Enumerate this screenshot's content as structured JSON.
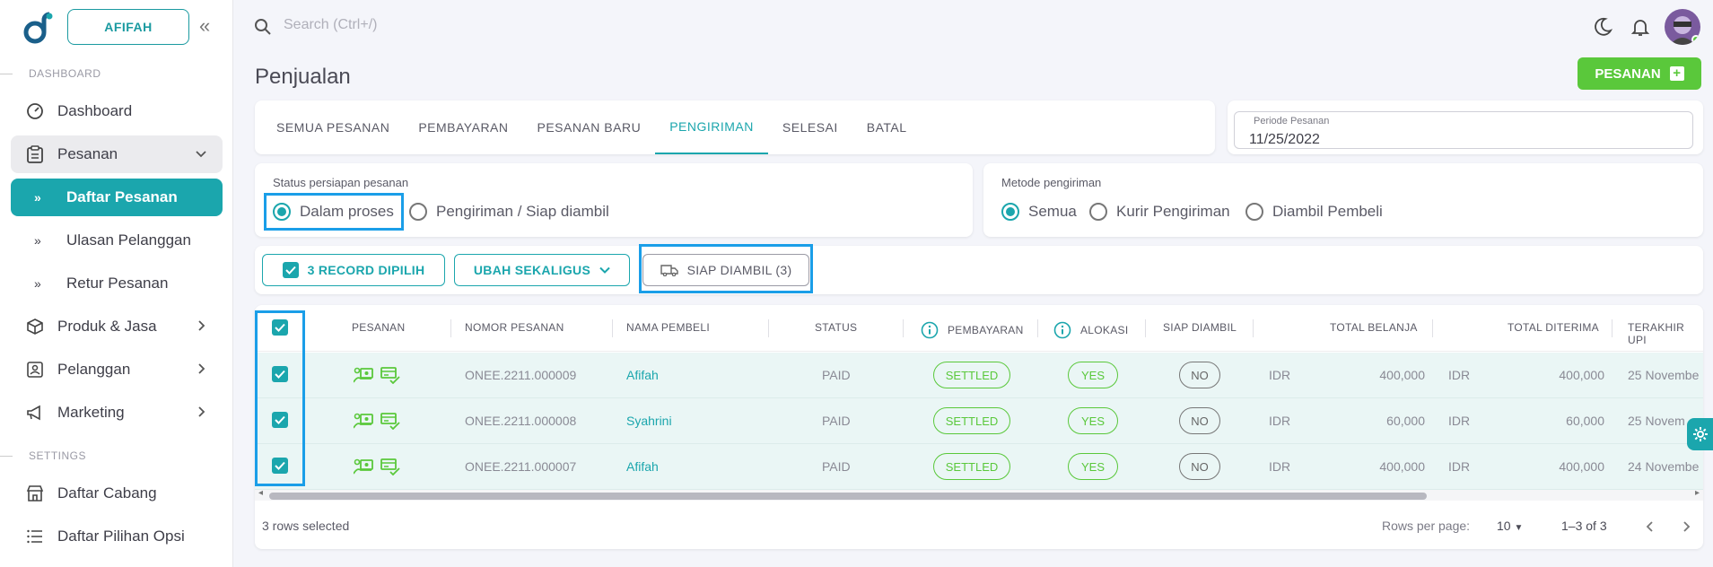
{
  "sidebar": {
    "org_label": "AFIFAH",
    "section_dashboard": "DASHBOARD",
    "section_settings": "SETTINGS",
    "items": {
      "dashboard": "Dashboard",
      "pesanan": "Pesanan",
      "daftar_pesanan": "Daftar Pesanan",
      "ulasan_pelanggan": "Ulasan Pelanggan",
      "retur_pesanan": "Retur Pesanan",
      "produk_jasa": "Produk & Jasa",
      "pelanggan": "Pelanggan",
      "marketing": "Marketing",
      "daftar_cabang": "Daftar Cabang",
      "daftar_pilihan_opsi": "Daftar Pilihan Opsi"
    }
  },
  "topbar": {
    "search_placeholder": "Search (Ctrl+/)"
  },
  "page": {
    "title": "Penjualan",
    "new_order_button": "PESANAN"
  },
  "tabs": [
    "SEMUA PESANAN",
    "PEMBAYARAN",
    "PESANAN BARU",
    "PENGIRIMAN",
    "SELESAI",
    "BATAL"
  ],
  "active_tab": "PENGIRIMAN",
  "periode": {
    "label": "Periode Pesanan",
    "value": "11/25/2022"
  },
  "status_filter": {
    "label": "Status persiapan pesanan",
    "options": [
      "Dalam proses",
      "Pengiriman / Siap diambil"
    ],
    "selected": "Dalam proses"
  },
  "metode_filter": {
    "label": "Metode pengiriman",
    "options": [
      "Semua",
      "Kurir Pengiriman",
      "Diambil Pembeli"
    ],
    "selected": "Semua"
  },
  "actions": {
    "selected_records": "3 RECORD DIPILIH",
    "bulk_change": "UBAH SEKALIGUS",
    "ready_pickup": "SIAP DIAMBIL (3)"
  },
  "table": {
    "headers": {
      "pesanan": "PESANAN",
      "nomor": "NOMOR PESANAN",
      "nama": "NAMA PEMBELI",
      "status": "STATUS",
      "pembayaran": "PEMBAYARAN",
      "alokasi": "ALOKASI",
      "siap": "SIAP DIAMBIL",
      "total_belanja": "TOTAL BELANJA",
      "total_diterima": "TOTAL DITERIMA",
      "terakhir": "TERAKHIR UPI"
    },
    "rows": [
      {
        "nomor": "ONEE.2211.000009",
        "nama": "Afifah",
        "status": "PAID",
        "pembayaran": "SETTLED",
        "alokasi": "YES",
        "siap": "NO",
        "cur1": "IDR",
        "belanja": "400,000",
        "cur2": "IDR",
        "diterima": "400,000",
        "terakhir": "25 Novembe"
      },
      {
        "nomor": "ONEE.2211.000008",
        "nama": "Syahrini",
        "status": "PAID",
        "pembayaran": "SETTLED",
        "alokasi": "YES",
        "siap": "NO",
        "cur1": "IDR",
        "belanja": "60,000",
        "cur2": "IDR",
        "diterima": "60,000",
        "terakhir": "25 Novem"
      },
      {
        "nomor": "ONEE.2211.000007",
        "nama": "Afifah",
        "status": "PAID",
        "pembayaran": "SETTLED",
        "alokasi": "YES",
        "siap": "NO",
        "cur1": "IDR",
        "belanja": "400,000",
        "cur2": "IDR",
        "diterima": "400,000",
        "terakhir": "24 Novembe"
      }
    ],
    "footer": {
      "selected_text": "3 rows selected",
      "rows_per_page_label": "Rows per page:",
      "rows_per_page": "10",
      "range": "1–3 of 3"
    }
  },
  "colors": {
    "primary": "#1ba6ad",
    "green": "#5ac83b",
    "highlight": "#1a9ee8"
  }
}
